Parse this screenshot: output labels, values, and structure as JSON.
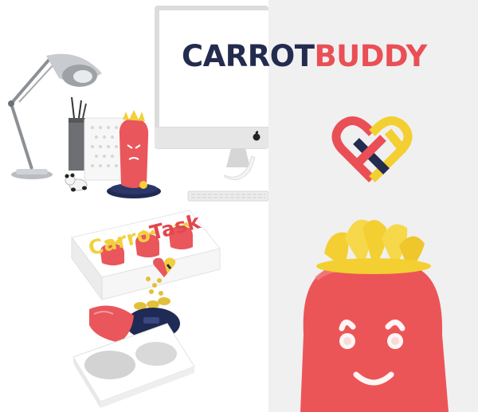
{
  "brand": {
    "word_part_1": "CARROT",
    "word_part_2": "BUDDY",
    "colors": {
      "navy": "#232b4f",
      "red": "#ea4f56",
      "yellow": "#f3cf32",
      "background": "#f0f0f1"
    }
  },
  "packaging": {
    "title_part_1": "Carro",
    "title_part_2": "Task"
  },
  "icons": {
    "logo": "interwoven-heart-icon",
    "monitor_badge": "apple-logo-icon"
  }
}
